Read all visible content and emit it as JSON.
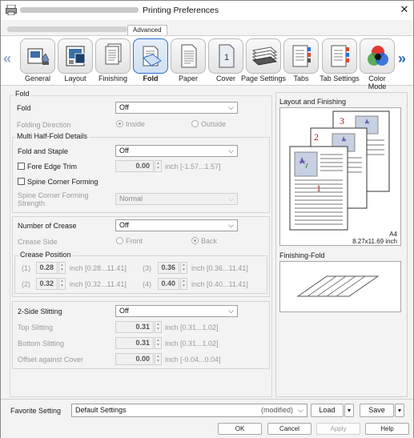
{
  "window": {
    "title": "Printing Preferences",
    "close_glyph": "✕"
  },
  "tabs": {
    "advanced": "Advanced"
  },
  "ribbon": {
    "items": [
      {
        "label": "General",
        "icon": "general-icon"
      },
      {
        "label": "Layout",
        "icon": "layout-icon"
      },
      {
        "label": "Finishing",
        "icon": "finishing-icon"
      },
      {
        "label": "Fold",
        "icon": "fold-icon",
        "active": true
      },
      {
        "label": "Paper",
        "icon": "paper-icon"
      },
      {
        "label": "Cover",
        "icon": "cover-icon"
      },
      {
        "label": "Page Settings",
        "icon": "page-settings-icon"
      },
      {
        "label": "Tabs",
        "icon": "tabs-icon"
      },
      {
        "label": "Tab Settings",
        "icon": "tab-settings-icon"
      },
      {
        "label": "Color\nMode",
        "icon": "color-mode-icon"
      }
    ],
    "cover_number": "1",
    "prev_glyph": "«",
    "next_glyph": "»"
  },
  "fold": {
    "section_title": "Fold",
    "fold_label": "Fold",
    "fold_value": "Off",
    "folding_direction_label": "Folding Direction",
    "inside_label": "Inside",
    "outside_label": "Outside"
  },
  "multi_half": {
    "group_title": "Multi Half-Fold Details",
    "fold_staple_label": "Fold and Staple",
    "fold_staple_value": "Off",
    "fore_edge_label": "Fore Edge Trim",
    "fore_edge_value": "0.00",
    "fore_edge_range": "inch [-1.57...1.57]",
    "spine_corner_label": "Spine Corner Forming",
    "spine_strength_label": "Spine Corner Forming Strength",
    "spine_strength_value": "Normal"
  },
  "crease": {
    "number_label": "Number of Crease",
    "number_value": "Off",
    "side_label": "Crease Side",
    "front_label": "Front",
    "back_label": "Back",
    "position_title": "Crease Position",
    "positions": [
      {
        "idx": "(1)",
        "value": "0.28",
        "range": "inch [0.28...11.41]"
      },
      {
        "idx": "(2)",
        "value": "0.32",
        "range": "inch [0.32...11.41]"
      },
      {
        "idx": "(3)",
        "value": "0.36",
        "range": "inch [0.36...11.41]"
      },
      {
        "idx": "(4)",
        "value": "0.40",
        "range": "inch [0.40...11.41]"
      }
    ]
  },
  "slitting": {
    "label": "2-Side Slitting",
    "value": "Off",
    "top_label": "Top Slitting",
    "top_value": "0.31",
    "top_range": "inch [0.31...1.02]",
    "bottom_label": "Bottom Slitting",
    "bottom_value": "0.31",
    "bottom_range": "inch [0.31...1.02]",
    "offset_label": "Offset against Cover",
    "offset_value": "0.00",
    "offset_range": "inch [-0.04...0.04]"
  },
  "preview": {
    "layout_title": "Layout and Finishing",
    "paper_size": "A4",
    "paper_dims": "8.27x11.69 inch",
    "page_numbers": [
      "3",
      "2",
      "1"
    ],
    "fold_title": "Finishing-Fold"
  },
  "bottom": {
    "favorite_label": "Favorite Setting",
    "favorite_value": "Default Settings",
    "favorite_modified": "(modified)",
    "load_label": "Load",
    "save_label": "Save",
    "ok_label": "OK",
    "cancel_label": "Cancel",
    "apply_label": "Apply",
    "help_label": "Help"
  }
}
